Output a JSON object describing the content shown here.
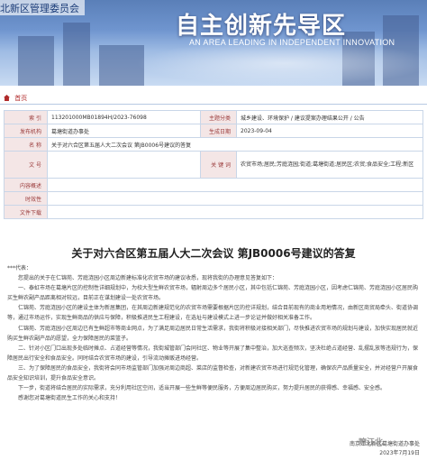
{
  "banner": {
    "org_name": "北新区管理委员会",
    "slogan_cn": "自主创新先导区",
    "slogan_en": "AN AREA LEADING IN INDEPENDENT INNOVATION"
  },
  "crumb": {
    "label": "首页"
  },
  "info": {
    "row1": {
      "label": "索  引",
      "value": "113201000MB01894H/2023-76098",
      "label2": "主题分类",
      "value2": "城乡建设、环境保护 / 建议提案办理结果公开 / 公告"
    },
    "row2": {
      "label": "发布机构",
      "value": "葛塘街道办事处",
      "label2": "生成日期",
      "value2": "2023-09-04"
    },
    "row3": {
      "label": "名  称",
      "value": "关于对六合区第五届人大二次会议 第JB0006号建议的答复"
    },
    "row4": {
      "label": "文  号",
      "value": "",
      "label2": "关 键 词",
      "value2": "农贸市场;居民;芳庭涟园;街道;葛塘街道;居民区;农贸;食品安全;工程;新区"
    },
    "row5": {
      "label": "内容概述",
      "value": ""
    },
    "row6": {
      "label": "时效性",
      "value": ""
    },
    "row7": {
      "label": "文件下载",
      "value": ""
    }
  },
  "doc": {
    "title": "关于对六合区第五届人大二次会议 第JB0006号建议的答复",
    "salutation": "***代表：",
    "paragraphs": [
      "您提出的关于在仁锦苑、芳庭涟园小区周边新建标准化农贸市场的建议收悉，现将我街的办理意见答复如下：",
      "一、泰虹市场在葛塘片区的控制性详细规划中，为校大型生鲜农贸市场，辐射周边多个居民小区，其中包括仁锦苑、芳庭涟园小区，因考虑仁锦苑、芳庭涟园小区居民购买生鲜农副产品距离相对较远，目前正在谋划建设一处农贸市场。",
      "仁锦苑、芳庭涟园小区的建设主体为新居集团，在其周边新建规范化的农贸市场需要根据片区的控详规划，结合目前现有的商业用地情况，由新区商贸局牵头、街道协调等，通过市场运作，实现生鲜商品的供应与保障，积极推进民生工程建设，在选址与建设模式上进一步论证并做好相关准备工作。",
      "仁锦苑、芳庭涟园小区周边已有生鲜超市等商业网点，为了满足周边居民日常生活需求，我街将积极对接相关部门，尽快推进农贸市场的规划与建设，加快实现居民就近购买生鲜农副产品的愿望，全力保障居民的菜篮子。",
      "二、针对小区门口出现多处临时摊点、占道经营等情况，我街城管部门会同社区、物业等开展了集中整治，加大巡查频次，坚决杜绝占道经营、乱摆乱放等违规行为，保障居民出行安全和食品安全。同时结合农贸市场的建设，引导流动摊贩进场经营。",
      "三、为了保障居民的食品安全，我街将会同市场监管部门加强对周边商超、菜店的监督检查，对新建农贸市场进行规范化管理，确保农产品质量安全，并对经营户开展食品安全知识培训，提升食品安全意识。",
      "下一步，街道将结合居民的实际需求，充分利用社区空间，适当开展一些生鲜等便民服务，方便周边居民购买，努力提升居民的获得感、幸福感、安全感。",
      "感谢您对葛塘街道民生工作的关心和支持！"
    ],
    "signature": "南京江北新区葛塘街道办事处",
    "date": "2023年7月19日",
    "watermark": "瞭江北"
  }
}
